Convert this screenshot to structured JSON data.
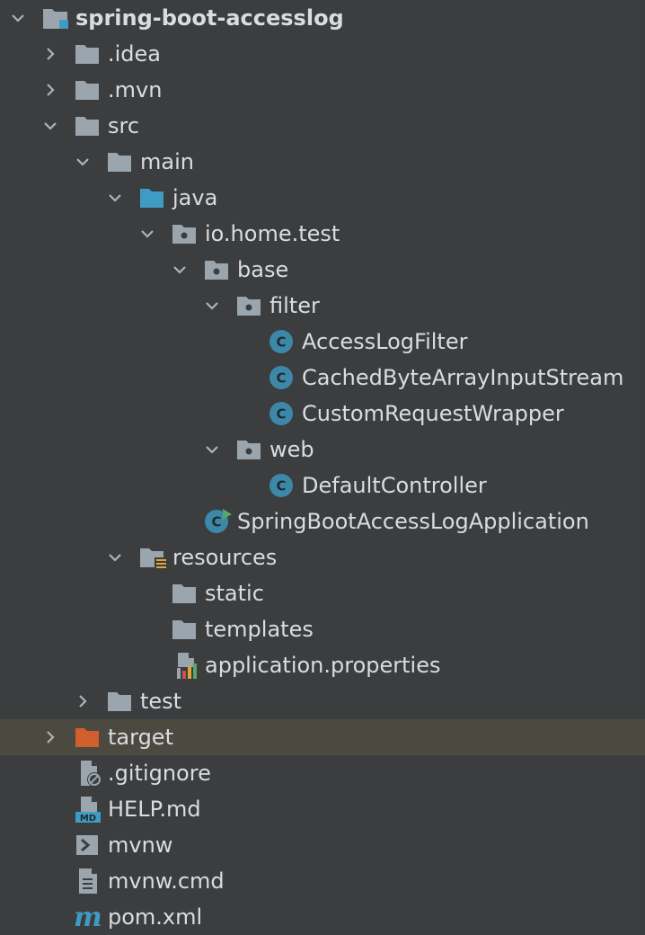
{
  "tree": {
    "root": "spring-boot-accesslog",
    "idea": ".idea",
    "mvn": ".mvn",
    "src": "src",
    "main": "main",
    "java": "java",
    "pkg": "io.home.test",
    "base": "base",
    "filter": "filter",
    "accessLogFilter": "AccessLogFilter",
    "cached": "CachedByteArrayInputStream",
    "customReq": "CustomRequestWrapper",
    "web": "web",
    "defaultController": "DefaultController",
    "appClass": "SpringBootAccessLogApplication",
    "resources": "resources",
    "static": "static",
    "templates": "templates",
    "appProps": "application.properties",
    "test": "test",
    "target": "target",
    "gitignore": ".gitignore",
    "help": "HELP.md",
    "mvnw": "mvnw",
    "mvnwcmd": "mvnw.cmd",
    "pom": "pom.xml"
  },
  "icons": {
    "md_badge": "MD",
    "class_letter": "C",
    "maven_letter": "m"
  },
  "colors": {
    "background": "#3b3d3f",
    "selected_row": "#4b4940",
    "folder": "#9aa5ad",
    "source_folder": "#3f9bc4",
    "excluded_folder": "#d15f2c",
    "class_icon": "#3d88a8"
  }
}
